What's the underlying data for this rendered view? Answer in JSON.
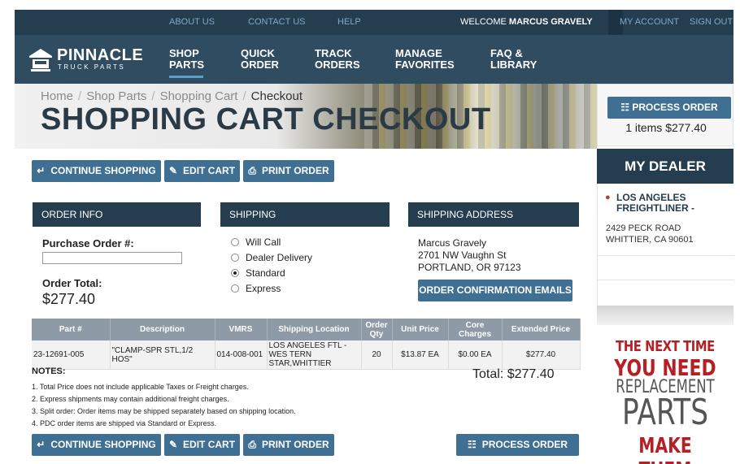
{
  "topbar": {
    "about_us": "ABOUT US",
    "contact_us": "CONTACT US",
    "help": "HELP",
    "welcome_prefix": "WELCOME",
    "welcome_name": "MARCUS GRAVELY",
    "my_account": "MY ACCOUNT",
    "sign_out": "SIGN OUT"
  },
  "brand": {
    "name": "PINNACLE",
    "subtitle": "TRUCK PARTS"
  },
  "nav": [
    {
      "line1": "SHOP",
      "line2": "PARTS"
    },
    {
      "line1": "QUICK",
      "line2": "ORDER"
    },
    {
      "line1": "TRACK",
      "line2": "ORDERS"
    },
    {
      "line1": "MANAGE",
      "line2": "FAVORITES"
    },
    {
      "line1": "FAQ &",
      "line2": "LIBRARY"
    }
  ],
  "breadcrumb": [
    "Home",
    "Shop Parts",
    "Shopping Cart",
    "Checkout"
  ],
  "page_title": "SHOPPING CART CHECKOUT",
  "sidebar": {
    "process_order": "PROCESS ORDER",
    "cart_summary": "1 items $277.40",
    "dealer_heading": "MY DEALER",
    "dealer_name": "LOS ANGELES FREIGHTLINER -",
    "dealer_street": "2429 PECK ROAD",
    "dealer_city": "WHITTIER, CA 90601"
  },
  "ad": {
    "line1": "THE NEXT TIME",
    "line2": "YOU NEED",
    "line3": "REPLACEMENT",
    "line4": "PARTS",
    "line5": "MAKE THEM"
  },
  "actions": {
    "continue_shopping": "CONTINUE SHOPPING",
    "edit_cart": "EDIT CART",
    "print_order": "PRINT ORDER",
    "process_order": "PROCESS ORDER"
  },
  "order_info": {
    "heading": "ORDER INFO",
    "po_label": "Purchase Order #:",
    "po_value": "",
    "total_label": "Order Total:",
    "total_value": "$277.40"
  },
  "shipping": {
    "heading": "SHIPPING",
    "options": [
      "Will Call",
      "Dealer Delivery",
      "Standard",
      "Express"
    ],
    "selected": "Standard"
  },
  "shipping_address": {
    "heading": "SHIPPING ADDRESS",
    "name": "Marcus Gravely",
    "street": "2701 NW Vaughn St",
    "city": "PORTLAND, OR 97123",
    "button": "ORDER CONFIRMATION EMAILS"
  },
  "table": {
    "headers": [
      "Part #",
      "Description",
      "VMRS",
      "Shipping Location",
      "Order Qty",
      "Unit Price",
      "Core Charges",
      "Extended Price"
    ],
    "rows": [
      [
        "23-12691-005",
        "\"CLAMP-SPR STL,1/2 HOS\"",
        "014-008-001",
        "LOS ANGELES FTL - WES TERN STAR,WHITTIER",
        "20",
        "$13.87 EA",
        "$0.00 EA",
        "$277.40"
      ]
    ]
  },
  "notes": {
    "heading": "NOTES:",
    "items": [
      "1. Total Price does not include applicable Taxes or Freight charges.",
      "2. Express shipments may contain additional freight charges.",
      "3. Split order: Order items may be shipped separately based on shipping location.",
      "4. PDC order items are shipped via Standard or Express."
    ]
  },
  "total_line": "Total: $277.40",
  "colors": {
    "dark_navy": "#243d4f",
    "nav_blue": "#2f4c61",
    "button_blue": "#3f6f93",
    "ad_red": "#b52025"
  }
}
